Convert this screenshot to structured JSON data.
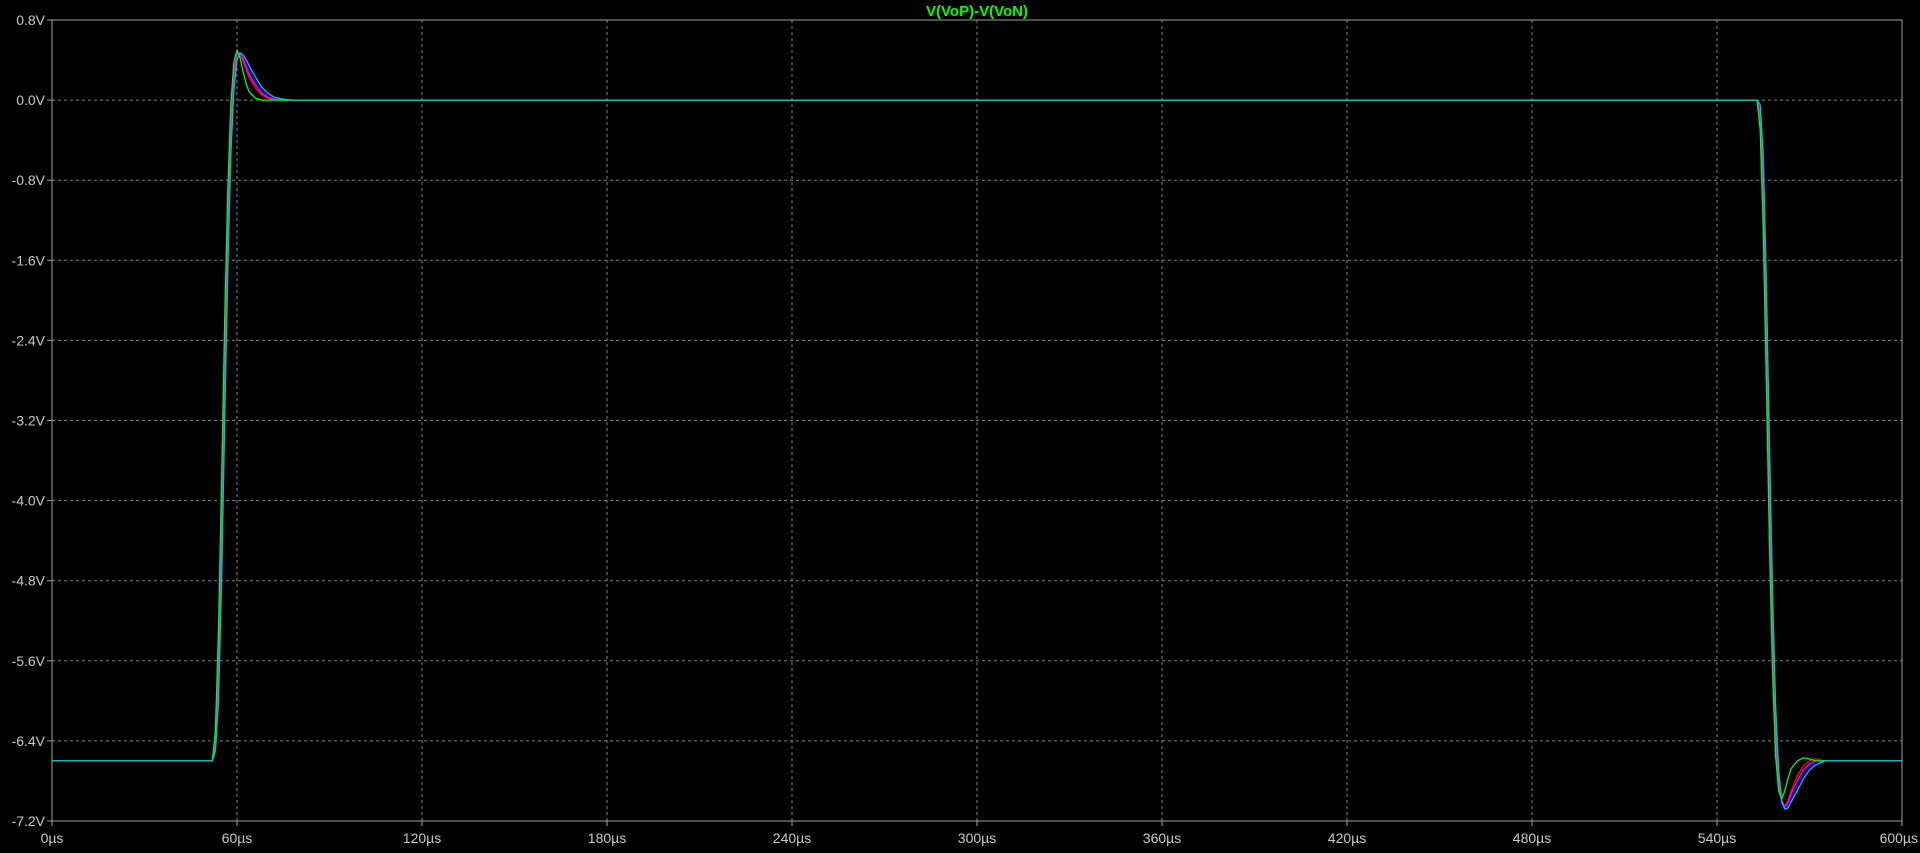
{
  "window": {
    "background_color": "#000000",
    "grid_color": "#808080",
    "frame_color": "#a0a0a0",
    "tick_text_color": "#c8c8c8"
  },
  "chart_data": {
    "type": "line",
    "title": "V(VoP)-V(VoN)",
    "title_color": "#00ff00",
    "xlabel": "",
    "ylabel": "",
    "xlim": [
      0,
      600
    ],
    "ylim": [
      -7.2,
      0.8
    ],
    "grid": true,
    "x_unit": "µs",
    "y_unit": "V",
    "x_ticks": [
      0,
      60,
      120,
      180,
      240,
      300,
      360,
      420,
      480,
      540,
      600
    ],
    "x_tick_labels": [
      "0µs",
      "60µs",
      "120µs",
      "180µs",
      "240µs",
      "300µs",
      "360µs",
      "420µs",
      "480µs",
      "540µs",
      "600µs"
    ],
    "y_ticks": [
      0.8,
      0.0,
      -0.8,
      -1.6,
      -2.4,
      -3.2,
      -4.0,
      -4.8,
      -5.6,
      -6.4,
      -7.2
    ],
    "y_tick_labels": [
      "0.8V",
      "0.0V",
      "-0.8V",
      "-1.6V",
      "-2.4V",
      "-3.2V",
      "-4.0V",
      "-4.8V",
      "-5.6V",
      "-6.4V",
      "-7.2V"
    ],
    "series": [
      {
        "color": "#ff0000",
        "x": [
          0,
          52,
          53,
          54,
          55,
          56,
          57,
          58,
          59,
          60,
          61,
          62,
          63,
          64,
          66,
          68,
          70,
          72,
          75,
          78,
          80,
          300,
          553,
          554,
          555,
          556,
          557,
          558,
          559,
          560,
          561,
          562,
          563,
          564,
          566,
          568,
          570,
          572,
          575,
          578,
          580,
          600
        ],
        "y": [
          -6.6,
          -6.6,
          -6.4,
          -5.6,
          -4.2,
          -2.6,
          -1.2,
          -0.2,
          0.3,
          0.47,
          0.46,
          0.38,
          0.3,
          0.22,
          0.12,
          0.05,
          0.02,
          0.0,
          0.0,
          0.0,
          0.0,
          0.0,
          0.0,
          -0.2,
          -1.0,
          -2.4,
          -4.0,
          -5.4,
          -6.4,
          -6.85,
          -7.0,
          -7.05,
          -7.0,
          -6.9,
          -6.75,
          -6.65,
          -6.6,
          -6.58,
          -6.6,
          -6.6,
          -6.6,
          -6.6
        ]
      },
      {
        "color": "#0000ff",
        "x": [
          0,
          52,
          53,
          54,
          55,
          56,
          57,
          58,
          59,
          60,
          61,
          62,
          63,
          64,
          66,
          68,
          70,
          72,
          75,
          78,
          80,
          300,
          553,
          554,
          555,
          556,
          557,
          558,
          559,
          560,
          561,
          562,
          563,
          564,
          566,
          568,
          570,
          572,
          575,
          578,
          580,
          600
        ],
        "y": [
          -6.6,
          -6.6,
          -6.5,
          -5.9,
          -4.6,
          -3.0,
          -1.5,
          -0.4,
          0.2,
          0.44,
          0.48,
          0.44,
          0.37,
          0.3,
          0.19,
          0.1,
          0.05,
          0.02,
          0.0,
          0.0,
          0.0,
          0.0,
          0.0,
          -0.1,
          -0.7,
          -2.0,
          -3.6,
          -5.1,
          -6.2,
          -6.8,
          -7.05,
          -7.08,
          -7.05,
          -6.98,
          -6.85,
          -6.74,
          -6.66,
          -6.62,
          -6.6,
          -6.6,
          -6.6,
          -6.6
        ]
      },
      {
        "color": "#ff00ff",
        "x": [
          0,
          52,
          53,
          54,
          55,
          56,
          57,
          58,
          59,
          60,
          61,
          62,
          63,
          64,
          66,
          68,
          70,
          72,
          75,
          78,
          80,
          300,
          553,
          554,
          555,
          556,
          557,
          558,
          559,
          560,
          561,
          562,
          563,
          564,
          566,
          568,
          570,
          572,
          575,
          578,
          580,
          600
        ],
        "y": [
          -6.6,
          -6.6,
          -6.45,
          -5.7,
          -4.3,
          -2.7,
          -1.3,
          -0.3,
          0.25,
          0.46,
          0.47,
          0.41,
          0.33,
          0.25,
          0.15,
          0.07,
          0.03,
          0.01,
          0.0,
          0.0,
          0.0,
          0.0,
          0.0,
          -0.15,
          -0.85,
          -2.2,
          -3.8,
          -5.25,
          -6.3,
          -6.83,
          -7.02,
          -7.06,
          -7.02,
          -6.93,
          -6.8,
          -6.69,
          -6.63,
          -6.6,
          -6.6,
          -6.6,
          -6.6,
          -6.6
        ]
      },
      {
        "color": "#00ff00",
        "x": [
          0,
          52,
          53,
          54,
          55,
          56,
          57,
          58,
          59,
          60,
          61,
          62,
          63,
          64,
          66,
          68,
          70,
          72,
          75,
          78,
          80,
          300,
          553,
          554,
          555,
          556,
          557,
          558,
          559,
          560,
          561,
          562,
          563,
          564,
          566,
          568,
          570,
          572,
          575,
          578,
          580,
          600
        ],
        "y": [
          -6.6,
          -6.6,
          -6.3,
          -5.3,
          -3.8,
          -2.2,
          -0.9,
          -0.05,
          0.38,
          0.5,
          0.42,
          0.28,
          0.16,
          0.08,
          0.02,
          0.0,
          0.0,
          0.0,
          0.0,
          0.0,
          0.0,
          0.0,
          0.0,
          -0.3,
          -1.3,
          -2.8,
          -4.4,
          -5.7,
          -6.55,
          -6.9,
          -6.98,
          -6.9,
          -6.78,
          -6.68,
          -6.6,
          -6.57,
          -6.58,
          -6.6,
          -6.6,
          -6.6,
          -6.6,
          -6.6
        ]
      },
      {
        "color": "#00c8c8",
        "x": [
          0,
          52,
          53,
          54,
          55,
          56,
          57,
          58,
          59,
          60,
          61,
          62,
          63,
          64,
          66,
          68,
          70,
          72,
          75,
          78,
          80,
          300,
          553,
          554,
          555,
          556,
          557,
          558,
          559,
          560,
          561,
          562,
          563,
          564,
          566,
          568,
          570,
          572,
          575,
          578,
          580,
          600
        ],
        "y": [
          -6.6,
          -6.6,
          -6.5,
          -6.0,
          -4.8,
          -3.2,
          -1.7,
          -0.55,
          0.1,
          0.4,
          0.47,
          0.45,
          0.4,
          0.34,
          0.23,
          0.13,
          0.07,
          0.03,
          0.01,
          0.0,
          0.0,
          0.0,
          0.0,
          -0.05,
          -0.55,
          -1.8,
          -3.4,
          -4.9,
          -6.05,
          -6.7,
          -7.0,
          -7.08,
          -7.07,
          -7.01,
          -6.9,
          -6.78,
          -6.69,
          -6.64,
          -6.6,
          -6.6,
          -6.6,
          -6.6
        ]
      }
    ]
  }
}
